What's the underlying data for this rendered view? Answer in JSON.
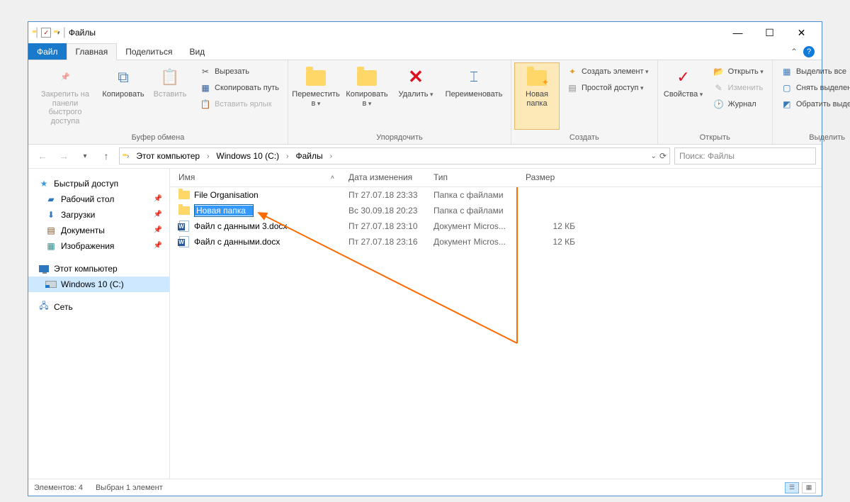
{
  "window": {
    "title": "Файлы"
  },
  "tabs": {
    "file": "Файл",
    "home": "Главная",
    "share": "Поделиться",
    "view": "Вид"
  },
  "ribbon": {
    "clipboard": {
      "label": "Буфер обмена",
      "pin": "Закрепить на панели\nбыстрого доступа",
      "copy": "Копировать",
      "paste": "Вставить",
      "cut": "Вырезать",
      "copy_path": "Скопировать путь",
      "paste_shortcut": "Вставить ярлык"
    },
    "organize": {
      "label": "Упорядочить",
      "move_to": "Переместить в",
      "copy_to": "Копировать в",
      "delete": "Удалить",
      "rename": "Переименовать"
    },
    "create": {
      "label": "Создать",
      "new_folder": "Новая папка",
      "new_item": "Создать элемент",
      "easy_access": "Простой доступ"
    },
    "open": {
      "label": "Открыть",
      "properties": "Свойства",
      "open": "Открыть",
      "edit": "Изменить",
      "history": "Журнал"
    },
    "select": {
      "label": "Выделить",
      "select_all": "Выделить все",
      "select_none": "Снять выделение",
      "invert": "Обратить выделение"
    }
  },
  "breadcrumb": {
    "items": [
      "Этот компьютер",
      "Windows 10 (C:)",
      "Файлы"
    ]
  },
  "search": {
    "placeholder": "Поиск: Файлы"
  },
  "sidebar": {
    "quick_access": "Быстрый доступ",
    "desktop": "Рабочий стол",
    "downloads": "Загрузки",
    "documents": "Документы",
    "pictures": "Изображения",
    "this_pc": "Этот компьютер",
    "drive": "Windows 10 (C:)",
    "network": "Сеть"
  },
  "columns": {
    "name": "Имя",
    "date": "Дата изменения",
    "type": "Тип",
    "size": "Размер"
  },
  "files": [
    {
      "name": "File Organisation",
      "date": "Пт 27.07.18 23:33",
      "type": "Папка с файлами",
      "size": "",
      "icon": "folder"
    },
    {
      "name": "Новая папка",
      "date": "Вс 30.09.18 20:23",
      "type": "Папка с файлами",
      "size": "",
      "icon": "folder",
      "renaming": true
    },
    {
      "name": "Файл с данными 3.docx",
      "date": "Пт 27.07.18 23:10",
      "type": "Документ Micros...",
      "size": "12 КБ",
      "icon": "word"
    },
    {
      "name": "Файл с данными.docx",
      "date": "Пт 27.07.18 23:16",
      "type": "Документ Micros...",
      "size": "12 КБ",
      "icon": "word"
    }
  ],
  "status": {
    "count": "Элементов: 4",
    "selected": "Выбран 1 элемент"
  }
}
